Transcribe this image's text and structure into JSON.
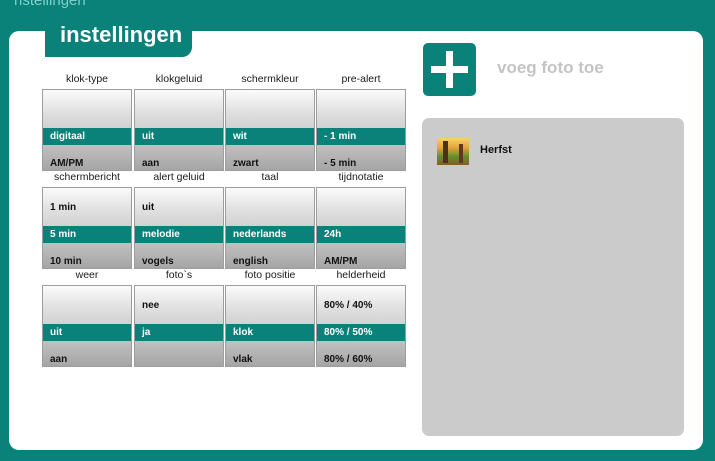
{
  "top_strip": "nstellingen",
  "title": "instellingen",
  "columns_x": [
    42,
    134,
    225,
    316
  ],
  "rows": [
    [
      {
        "label": "klok-type",
        "options": [
          "",
          "digitaal",
          "AM/PM"
        ],
        "selected": 1
      },
      {
        "label": "klokgeluid",
        "options": [
          "",
          "uit",
          "aan"
        ],
        "selected": 1
      },
      {
        "label": "schermkleur",
        "options": [
          "",
          "wit",
          "zwart"
        ],
        "selected": 1
      },
      {
        "label": "pre-alert",
        "options": [
          "",
          "- 1 min",
          "- 5 min"
        ],
        "selected": 1
      }
    ],
    [
      {
        "label": "schermbericht",
        "options": [
          "1 min",
          "5 min",
          "10 min"
        ],
        "selected": 1
      },
      {
        "label": "alert geluid",
        "options": [
          "uit",
          "melodie",
          "vogels"
        ],
        "selected": 1
      },
      {
        "label": "taal",
        "options": [
          "",
          "nederlands",
          "english"
        ],
        "selected": 1
      },
      {
        "label": "tijdnotatie",
        "options": [
          "",
          "24h",
          "AM/PM"
        ],
        "selected": 1
      }
    ],
    [
      {
        "label": "weer",
        "options": [
          "",
          "uit",
          "aan"
        ],
        "selected": 1
      },
      {
        "label": "foto`s",
        "options": [
          "nee",
          "ja",
          ""
        ],
        "selected": 1
      },
      {
        "label": "foto positie",
        "options": [
          "",
          "klok",
          "vlak"
        ],
        "selected": 1
      },
      {
        "label": "helderheid",
        "options": [
          "80% / 40%",
          "80% / 50%",
          "80% / 60%"
        ],
        "selected": 1
      }
    ]
  ],
  "add_photo": {
    "icon": "plus-icon",
    "label": "voeg foto toe"
  },
  "photos": [
    {
      "name": "Herfst",
      "icon": "autumn-thumbnail"
    }
  ],
  "colors": {
    "accent": "#0a8179",
    "panel": "#ffffff",
    "photo_panel": "#cbcbcb"
  }
}
